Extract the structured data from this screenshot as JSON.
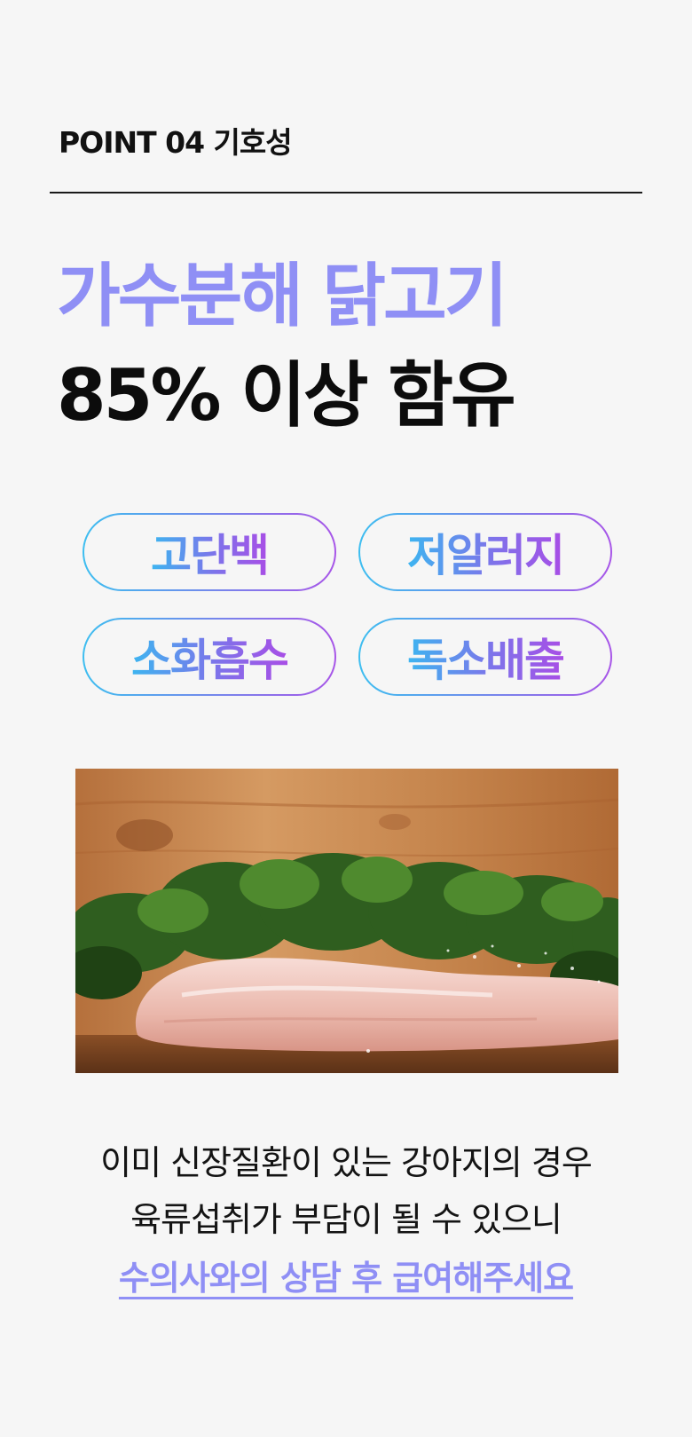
{
  "point_label": "POINT 04 기호성",
  "headline": {
    "line1": "가수분해 닭고기",
    "line2": "85% 이상 함유"
  },
  "tags": [
    "고단백",
    "저알러지",
    "소화흡수",
    "독소배출"
  ],
  "colors": {
    "accent": "#8f8ff5",
    "tag_gradient_start": "#3db5f0",
    "tag_gradient_end": "#a84ee6",
    "background": "#f6f6f6"
  },
  "photo": {
    "icon": "chicken-breast-image"
  },
  "description": {
    "line1": "이미 신장질환이 있는 강아지의 경우",
    "line2": "육류섭취가 부담이 될 수 있으니",
    "cta": "수의사와의 상담 후 급여해주세요"
  }
}
